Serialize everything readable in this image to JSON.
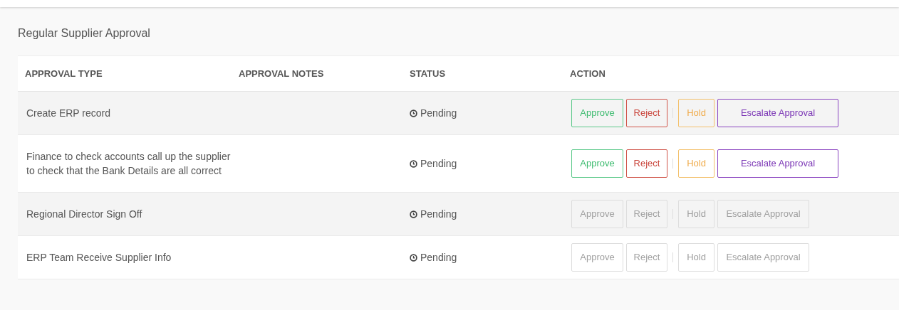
{
  "title": "Regular Supplier Approval",
  "columns": [
    "APPROVAL TYPE",
    "APPROVAL NOTES",
    "STATUS",
    "ACTION"
  ],
  "rows": [
    {
      "approval_type": "Create ERP record",
      "status": "Pending",
      "disabled": false,
      "actions": [
        {
          "kind": "approve",
          "label": "Approve"
        },
        {
          "kind": "reject",
          "label": "Reject"
        },
        {
          "kind": "hold",
          "label": "Hold"
        },
        {
          "kind": "escalate",
          "label": "Escalate Approval"
        }
      ]
    },
    {
      "approval_type": "Finance to check accounts call up the supplier to check that the Bank Details are all correct",
      "status": "Pending",
      "disabled": false,
      "actions": [
        {
          "kind": "approve",
          "label": "Approve"
        },
        {
          "kind": "reject",
          "label": "Reject"
        },
        {
          "kind": "hold",
          "label": "Hold"
        },
        {
          "kind": "escalate",
          "label": "Escalate Approval"
        }
      ]
    },
    {
      "approval_type": "Regional Director Sign Off",
      "status": "Pending",
      "disabled": true,
      "actions": [
        {
          "kind": "approve",
          "label": "Approve"
        },
        {
          "kind": "reject",
          "label": "Reject"
        },
        {
          "kind": "hold",
          "label": "Hold"
        },
        {
          "kind": "escalate",
          "label": "Escalate Approval"
        }
      ]
    },
    {
      "approval_type": "ERP Team Receive Supplier Info",
      "status": "Pending",
      "disabled": true,
      "actions": [
        {
          "kind": "approve",
          "label": "Approve"
        },
        {
          "kind": "reject",
          "label": "Reject"
        },
        {
          "kind": "hold",
          "label": "Hold"
        },
        {
          "kind": "escalate",
          "label": "Escalate Approval"
        }
      ]
    }
  ]
}
